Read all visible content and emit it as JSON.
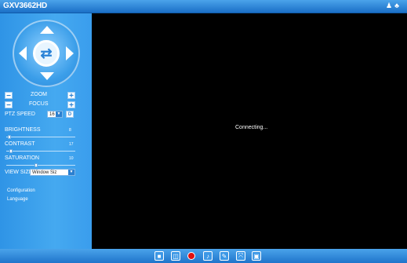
{
  "header": {
    "title": "GXV3662HD"
  },
  "sidebar": {
    "zoom_label": "ZOOM",
    "focus_label": "FOCUS",
    "minus_symbol": "−",
    "plus_symbol": "+",
    "ptz_speed": {
      "label": "PTZ SPEED",
      "value": "16",
      "button": "D"
    },
    "brightness": {
      "label": "BRIGHTNESS",
      "value": "8"
    },
    "contrast": {
      "label": "CONTRAST",
      "value": "17"
    },
    "saturation": {
      "label": "SATURATION",
      "value": "10"
    },
    "view_size": {
      "label": "VIEW SIZE",
      "value": "Window Siz"
    },
    "links": [
      "Configuration",
      "Language"
    ]
  },
  "video": {
    "status": "Connecting..."
  },
  "colors": {
    "accent": "#2a7fd0",
    "record": "#e01010",
    "video_bg": "#000000"
  },
  "toolbar_icons": [
    "stop-icon",
    "snapshot-icon",
    "record-icon",
    "audio-icon",
    "talk-icon",
    "fullscreen-icon",
    "save-icon"
  ]
}
